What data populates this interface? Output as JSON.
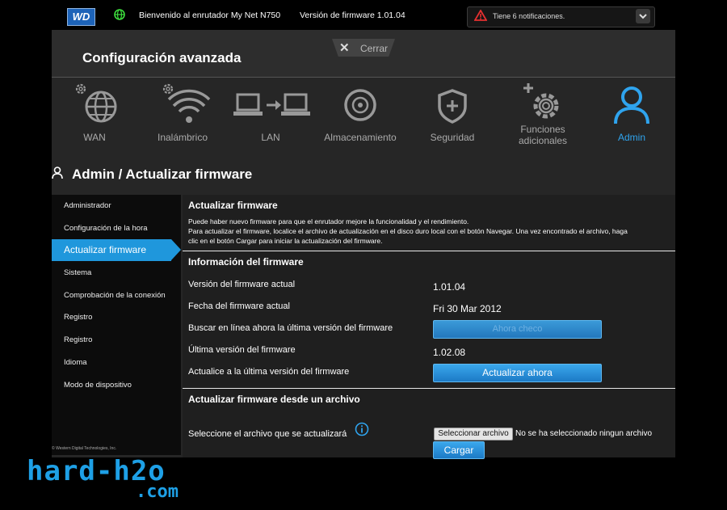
{
  "topbar": {
    "logo_text": "WD",
    "welcome": "Bienvenido al enrutador My Net N750",
    "firmware_version": "Versión de firmware 1.01.04",
    "notifications": "Tiene 6 notificaciones."
  },
  "header": {
    "title": "Configuración avanzada",
    "close_label": "Cerrar"
  },
  "categories": [
    {
      "label": "WAN",
      "icon": "globe-gear-icon"
    },
    {
      "label": "Inalámbrico",
      "icon": "wifi-gear-icon"
    },
    {
      "label": "LAN",
      "icon": "lan-computers-icon"
    },
    {
      "label": "Almacenamiento",
      "icon": "storage-disc-icon"
    },
    {
      "label": "Seguridad",
      "icon": "shield-icon"
    },
    {
      "label": "Funciones adicionales",
      "icon": "plus-gear-icon"
    },
    {
      "label": "Admin",
      "icon": "user-icon",
      "active": true
    }
  ],
  "section_title": "Admin / Actualizar firmware",
  "sidebar": {
    "items": [
      "Administrador",
      "Configuración de la hora",
      "Actualizar firmware",
      "Sistema",
      "Comprobación de la conexión",
      "Registro",
      "Registro",
      "Idioma",
      "Modo de dispositivo"
    ],
    "active_index": 2
  },
  "content": {
    "update_title": "Actualizar firmware",
    "update_desc_1": "Puede haber nuevo firmware para que el enrutador mejore la funcionalidad y el rendimiento.",
    "update_desc_2": "Para actualizar el firmware, localice el archivo de actualización en el disco duro local con el botón Navegar. Una vez encontrado el archivo, haga",
    "update_desc_3": "clic en el botón Cargar para iniciar la actualización del firmware.",
    "info_title": "Información del firmware",
    "rows": [
      {
        "label": "Versión del firmware actual",
        "value": "1.01.04"
      },
      {
        "label": "Fecha del firmware actual",
        "value": "Fri 30 Mar 2012"
      },
      {
        "label": "Buscar en línea ahora la última versión del firmware",
        "button": "Ahora checo"
      },
      {
        "label": "Última versión del firmware",
        "value": "1.02.08"
      },
      {
        "label": "Actualice a la última versión del firmware",
        "button": "Actualizar ahora"
      }
    ],
    "file_title": "Actualizar firmware desde un archivo",
    "file_label": "Seleccione el archivo que se actualizará",
    "file_button": "Seleccionar archivo",
    "file_status": "No se ha seleccionado ningun archivo",
    "upload_button": "Cargar"
  },
  "footer": {
    "copyright": "© Western Digital Technologies, Inc."
  },
  "watermark": {
    "line1": "hard-h2o",
    "line2": ".com"
  },
  "colors": {
    "accent": "#1f97dc",
    "active_category": "#2fa4ee",
    "watermark": "#1ea0e6"
  }
}
